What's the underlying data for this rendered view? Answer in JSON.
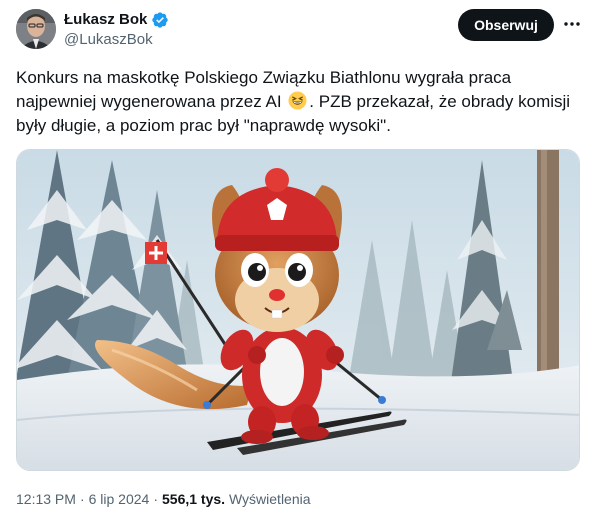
{
  "author": {
    "name": "Łukasz Bok",
    "handle": "@LukaszBok",
    "verified": true
  },
  "actions": {
    "follow_label": "Obserwuj",
    "more_icon": "more-horizontal-icon"
  },
  "tweet": {
    "text_part1": "Konkurs na maskotkę Polskiego Związku Biathlonu wygrała praca najpewniej wygenerowana przez AI",
    "emoji": "grinning-squinting-face",
    "text_part2": ". PZB przekazał, że obrady komisji były długie, a poziom prac był \"naprawdę wysoki\"."
  },
  "meta": {
    "time": "12:13 PM",
    "date": "6 lip 2024",
    "views_count": "556,1 tys.",
    "views_label": "Wyświetlenia",
    "separator": "·"
  },
  "colors": {
    "verified_blue": "#1d9bf0",
    "follow_bg": "#0f1419",
    "secondary_text": "#536471"
  }
}
